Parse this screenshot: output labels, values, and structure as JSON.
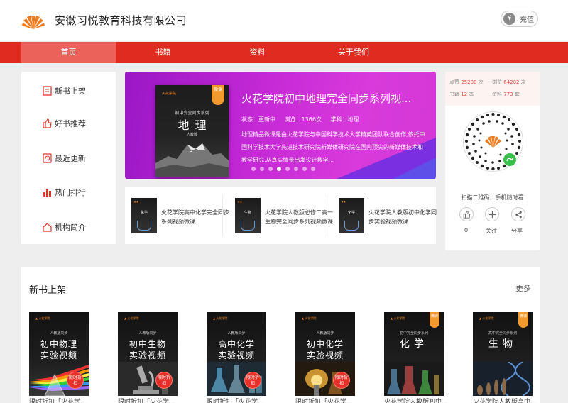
{
  "header": {
    "company": "安徽习悦教育科技有限公司",
    "recharge_label": "充值"
  },
  "nav": {
    "items": [
      {
        "label": "首页",
        "active": true
      },
      {
        "label": "书籍",
        "active": false
      },
      {
        "label": "资料",
        "active": false
      },
      {
        "label": "关于我们",
        "active": false
      }
    ]
  },
  "menu": {
    "items": [
      {
        "label": "新书上架",
        "icon": "book-icon"
      },
      {
        "label": "好书推荐",
        "icon": "thumbs-up-icon"
      },
      {
        "label": "最近更新",
        "icon": "refresh-icon"
      },
      {
        "label": "热门排行",
        "icon": "bar-chart-icon"
      },
      {
        "label": "机构简介",
        "icon": "home-icon"
      }
    ]
  },
  "banner": {
    "title": "火花学院初中地理完全同步系列视...",
    "status": "状态：更新中",
    "views": "浏览：1366次",
    "subject": "学科：地理",
    "description": "地理精品微课是由火花学院与中国科学技术大学精英团队联合创作,依托中国科学技术大学先进技术研究院新媒体研究院在国内顶尖的新媒体技术和教学研究,从真实情景出发设计教学...",
    "cover": {
      "logo": "火花学院",
      "series": "初中完全同步系列",
      "title": "地理",
      "edition": "人教版",
      "tag": "微课"
    },
    "slides": 8,
    "active_slide": 3
  },
  "thumbs": [
    {
      "text": "火花学院高中化学完全同步系列视频微课",
      "cover": "化学"
    },
    {
      "text": "火花学院人教版必修二高一生物完全同步系列视频微课",
      "cover": "生物"
    },
    {
      "text": "火花学院人教版初中化学同步实验视频微课",
      "cover": "化学"
    }
  ],
  "stats": {
    "likes_label": "点赞",
    "likes_value": "25200",
    "likes_unit": "次",
    "views_label": "浏览",
    "views_value": "64202",
    "views_unit": "次",
    "books_label": "书籍",
    "books_value": "12",
    "books_unit": "本",
    "materials_label": "资料",
    "materials_value": "773",
    "materials_unit": "套"
  },
  "qr": {
    "caption": "扫描二维码，手机随时看"
  },
  "actions": [
    {
      "label": "0",
      "icon": "thumbs-up-icon"
    },
    {
      "label": "关注",
      "icon": "plus-icon"
    },
    {
      "label": "分享",
      "icon": "share-icon"
    }
  ],
  "section": {
    "title": "新书上架",
    "more": "更多",
    "books": [
      {
        "title_line1": "初中物理",
        "title_line2": "实验视频",
        "sub": "人教版同步",
        "tag": "限时折扣",
        "caption": "限时折扣「火花学..."
      },
      {
        "title_line1": "初中生物",
        "title_line2": "实验视频",
        "sub": "人教版同步",
        "tag": "限时折扣",
        "caption": "限时折扣「火花学..."
      },
      {
        "title_line1": "高中化学",
        "title_line2": "实验视频",
        "sub": "人教版同步",
        "tag": "限时折扣",
        "caption": "限时折扣「火花学..."
      },
      {
        "title_line1": "初中化学",
        "title_line2": "实验视频",
        "sub": "人教版同步",
        "tag": "限时折扣",
        "caption": "限时折扣「火花学..."
      },
      {
        "title_line1": "化学",
        "title_line2": "",
        "sub": "初中完全同步系列",
        "tag": "微课",
        "caption": "火花学院人教版初中..."
      },
      {
        "title_line1": "生物",
        "title_line2": "",
        "sub": "高中完全同步系列",
        "tag": "微课",
        "caption": "火花学院人教版高中..."
      }
    ]
  },
  "colors": {
    "brand_red": "#e02b20",
    "nav_active": "#ea6259",
    "banner_purple": "#c62ad6",
    "accent_orange": "#f08a2a"
  }
}
